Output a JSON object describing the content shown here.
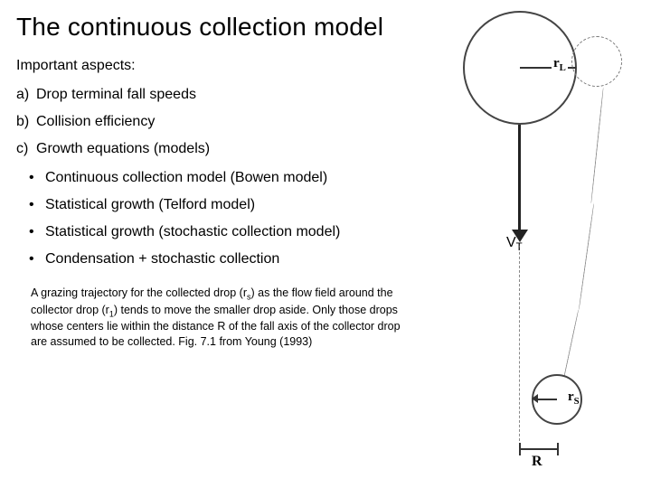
{
  "title": "The continuous collection model",
  "subhead": "Important aspects:",
  "aspects": [
    {
      "marker": "a)",
      "text": "Drop terminal fall speeds"
    },
    {
      "marker": "b)",
      "text": "Collision efficiency"
    },
    {
      "marker": "c)",
      "text": "Growth equations (models)"
    }
  ],
  "models": [
    "Continuous collection model (Bowen model)",
    "Statistical growth (Telford model)",
    "Statistical growth (stochastic collection model)",
    "Condensation + stochastic collection"
  ],
  "caption_parts": {
    "p1": "A grazing trajectory for the collected drop (r",
    "sub_s1": "s",
    "p2": ") as the flow field around the collector drop (r",
    "sub_1": "1",
    "p3": ") tends to move the smaller drop aside.  Only those drops whose centers lie within the distance R of the fall axis of the collector drop are assumed to be collected.  Fig. 7.1 from Young (1993)"
  },
  "diagram": {
    "rL_label": "r",
    "rL_sub": "L",
    "rS_label": "r",
    "rS_sub": "S",
    "R_label": "R",
    "VT_label": "V",
    "VT_sub": "T"
  }
}
